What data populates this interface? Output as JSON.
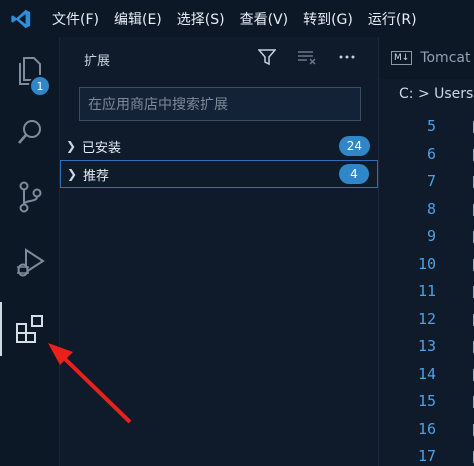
{
  "menubar": {
    "items": [
      "文件(F)",
      "编辑(E)",
      "选择(S)",
      "查看(V)",
      "转到(G)",
      "运行(R)"
    ]
  },
  "activity": {
    "explorer_badge": "1"
  },
  "sidebar": {
    "title": "扩展",
    "search_placeholder": "在应用商店中搜索扩展",
    "sections": [
      {
        "label": "已安装",
        "count": "24"
      },
      {
        "label": "推荐",
        "count": "4"
      }
    ]
  },
  "editor": {
    "tab_icon": "M↓",
    "tab_label": "Tomcat",
    "breadcrumb": "C: > Users",
    "line_numbers": [
      "5",
      "6",
      "7",
      "8",
      "9",
      "10",
      "11",
      "12",
      "13",
      "14",
      "15",
      "16",
      "17"
    ]
  },
  "colors": {
    "accent": "#2f86c8",
    "line_number": "#4aa2e6",
    "arrow": "#e8221b"
  }
}
